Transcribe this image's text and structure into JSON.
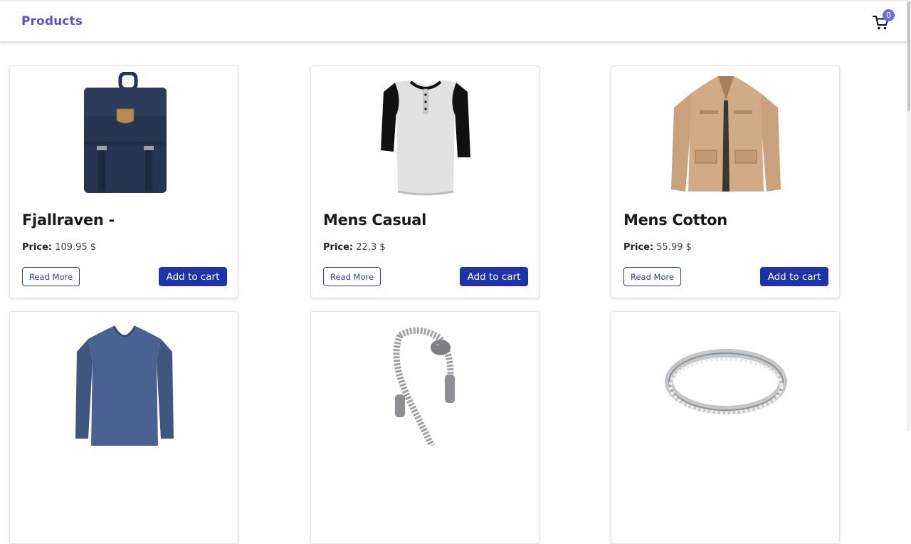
{
  "header": {
    "brand": "Products",
    "cart_count": "0",
    "cart_icon": "cart-icon"
  },
  "products": [
    {
      "title": "Fjallraven -",
      "price_label": "Price:",
      "price": "109.95 $",
      "read_more": "Read More",
      "add_to_cart": "Add to cart",
      "image": "backpack-image"
    },
    {
      "title": "Mens Casual",
      "price_label": "Price:",
      "price": "22.3 $",
      "read_more": "Read More",
      "add_to_cart": "Add to cart",
      "image": "raglan-shirt-image"
    },
    {
      "title": "Mens Cotton",
      "price_label": "Price:",
      "price": "55.99 $",
      "read_more": "Read More",
      "add_to_cart": "Add to cart",
      "image": "cotton-jacket-image"
    },
    {
      "image": "long-sleeve-tee-image"
    },
    {
      "image": "dragon-bracelet-image"
    },
    {
      "image": "silver-ring-image"
    }
  ],
  "colors": {
    "brand": "#5a4fd6",
    "button": "#1f33a8",
    "badge": "#6b6be6"
  }
}
